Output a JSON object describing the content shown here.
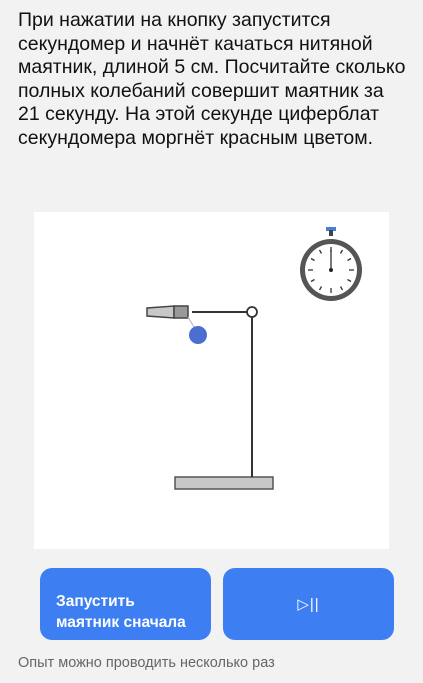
{
  "task": {
    "text": "При нажатии на кнопку запустится секундомер и начнёт качаться нитяной маятник, длиной 5 см. Посчитайте сколько полных колебаний совершит маятник за 21 секунду. На этой секунде циферблат секундомера моргнёт красным цветом."
  },
  "buttons": {
    "restart_line1": "Запустить",
    "restart_line2": "маятник сначала",
    "play_pause": "▷||"
  },
  "footer": {
    "hint": "Опыт можно проводить несколько раз"
  },
  "colors": {
    "accent": "#3d7ff2",
    "bob": "#4a6fd1",
    "stand": "#333333",
    "base": "#c8c8c8"
  },
  "icons": {
    "stopwatch": "stopwatch-icon",
    "play_pause": "play-pause-icon"
  }
}
